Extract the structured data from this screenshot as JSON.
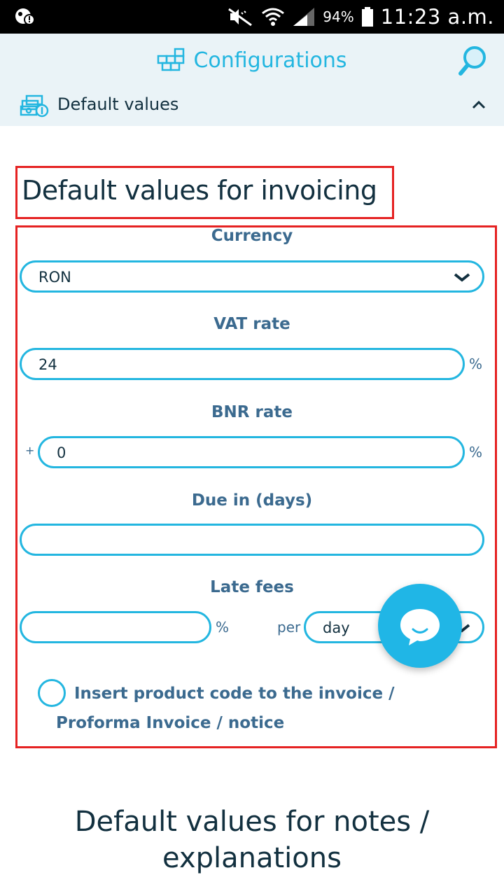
{
  "status_bar": {
    "battery": "94%",
    "time": "11:23 a.m."
  },
  "header": {
    "title": "Configurations",
    "section": "Default values"
  },
  "main": {
    "heading": "Default values for invoicing",
    "currency": {
      "label": "Currency",
      "value": "RON"
    },
    "vat": {
      "label": "VAT rate",
      "value": "24",
      "suffix": "%"
    },
    "bnr": {
      "label": "BNR rate",
      "prefix": "+",
      "value": "0",
      "suffix": "%"
    },
    "due": {
      "label": "Due in (days)",
      "value": ""
    },
    "late_fees": {
      "label": "Late fees",
      "value": "",
      "suffix": "%",
      "per_label": "per",
      "period": "day"
    },
    "checkbox_label": "Insert product code to the invoice / Proforma Invoice / notice",
    "next_heading": "Default values for notes / explanations"
  },
  "colors": {
    "accent": "#23b6e0",
    "label": "#3b6a8f",
    "highlight": "#e52222",
    "header_bg": "#eaf3f7"
  },
  "icons": [
    "notification-icon",
    "mute-icon",
    "wifi-icon",
    "signal-icon",
    "battery-icon",
    "configurations-icon",
    "search-icon",
    "money-icon",
    "chevron-up-icon",
    "chevron-down-icon",
    "chat-icon"
  ]
}
